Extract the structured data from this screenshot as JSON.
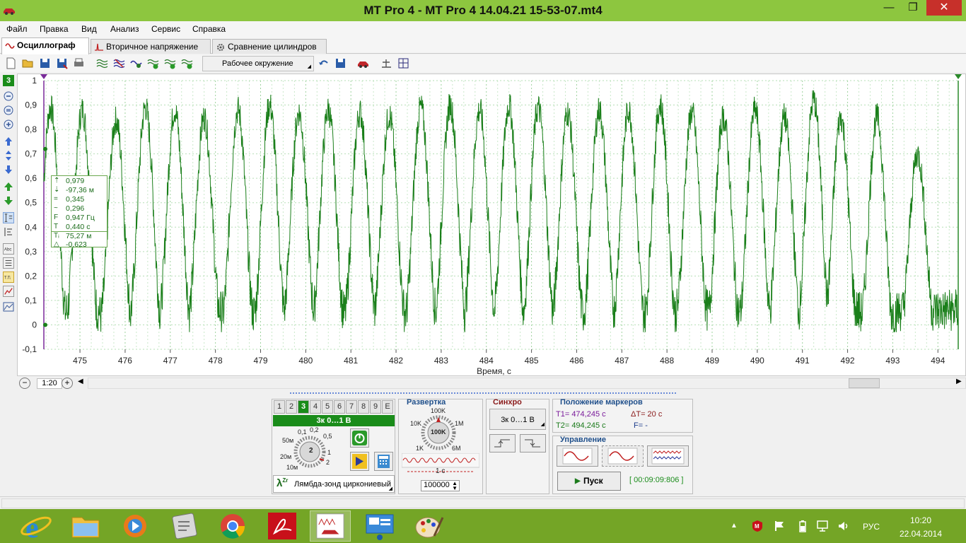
{
  "window": {
    "title": "MT Pro 4 - MT Pro 4 14.04.21 15-53-07.mt4",
    "min": "—",
    "max": "❐",
    "close": "✕"
  },
  "menu": [
    "Файл",
    "Правка",
    "Вид",
    "Анализ",
    "Сервис",
    "Справка"
  ],
  "tabs": [
    {
      "label": "Осциллограф",
      "active": true
    },
    {
      "label": "Вторичное напряжение",
      "active": false
    },
    {
      "label": "Сравнение цилиндров",
      "active": false
    }
  ],
  "toolbar": {
    "environment": "Рабочее окружение"
  },
  "channel_indicator": "3",
  "chart_data": {
    "type": "line",
    "title": "",
    "xlabel": "Время, с",
    "ylabel": "",
    "xlim": [
      474.2,
      494.45
    ],
    "ylim": [
      -0.1,
      1.0
    ],
    "x_ticks": [
      "475",
      "476",
      "477",
      "478",
      "479",
      "480",
      "481",
      "482",
      "483",
      "484",
      "485",
      "486",
      "487",
      "488",
      "489",
      "490",
      "491",
      "492",
      "493",
      "494"
    ],
    "y_ticks": [
      "1",
      "0,9",
      "0,8",
      "0,7",
      "0,6",
      "0,5",
      "0,4",
      "0,3",
      "0,2",
      "0,1",
      "0",
      "-0,1"
    ],
    "grid": true,
    "series": [
      {
        "color": "#1a7f1a",
        "description_peaks_x": [
          474.35,
          475.05,
          475.8,
          476.45,
          477.1,
          477.75,
          478.5,
          479.2,
          479.85,
          480.5,
          481.2,
          481.85,
          482.55,
          483.2,
          483.85,
          484.5,
          485.15,
          485.8,
          486.5,
          487.15,
          487.85,
          488.55,
          489.25,
          489.95,
          490.6,
          491.25,
          491.85,
          492.65,
          493.55
        ],
        "peak_values": [
          0.89,
          0.88,
          0.84,
          0.89,
          0.88,
          0.85,
          0.88,
          0.9,
          0.87,
          0.88,
          0.87,
          0.86,
          0.89,
          0.9,
          0.88,
          0.9,
          0.89,
          0.87,
          0.88,
          0.88,
          0.9,
          0.87,
          0.85,
          0.88,
          0.85,
          0.92,
          0.85,
          0.85,
          0.7
        ],
        "trough_values": [
          0.05,
          0.06,
          0.04,
          0.05,
          0.05,
          0.06,
          0.05,
          0.05,
          0.06,
          0.05,
          0.05,
          0.06,
          0.05,
          0.05,
          0.06,
          0.05,
          0.05,
          0.05,
          0.06,
          0.05,
          0.05,
          0.06,
          0.05,
          0.05,
          0.05,
          0.06,
          0.06,
          0.05,
          0.06
        ]
      }
    ]
  },
  "measurements": [
    {
      "symbol": "⇡",
      "value": "0,979"
    },
    {
      "symbol": "⇣",
      "value": "-97,36 м"
    },
    {
      "symbol": "=",
      "value": "0,345"
    },
    {
      "symbol": "~",
      "value": "0,296"
    },
    {
      "symbol": "F",
      "value": "0,947 Гц"
    },
    {
      "symbol": "T",
      "value": "0,440 с"
    },
    {
      "symbol": "Tᵢ",
      "value": "75,27 м"
    },
    {
      "symbol": "△",
      "value": "-0,623"
    }
  ],
  "zoom": {
    "value": "1:20"
  },
  "channels": {
    "buttons": [
      "1",
      "2",
      "3",
      "4",
      "5",
      "6",
      "7",
      "8",
      "9",
      "E"
    ],
    "active": "3",
    "range_label": "3к 0…1 В",
    "knob_labels": [
      "0,1",
      "0,2",
      "0,5",
      "50м",
      "1",
      "20м",
      "2",
      "10м"
    ],
    "knob_value": "2",
    "sensor": "Лямбда-зонд циркониевый"
  },
  "sweep": {
    "title": "Развертка",
    "labels": [
      "100K",
      "10K",
      "1M",
      "1K",
      "6M"
    ],
    "knob_value": "100K",
    "period": "1 с",
    "samples": "100000"
  },
  "sync": {
    "title": "Синхро",
    "source": "3к 0…1 В"
  },
  "markers": {
    "title": "Положение маркеров",
    "t1": "T1= 474,245 с",
    "t2": "T2= 494,245 с",
    "dt": "ΔT= 20 с",
    "f": "F= -"
  },
  "control": {
    "title": "Управление",
    "start": "Пуск",
    "timer": "[ 00:09:09:806 ]"
  },
  "taskbar": {
    "language": "РУС",
    "time": "10:20",
    "date": "22.04.2014"
  }
}
